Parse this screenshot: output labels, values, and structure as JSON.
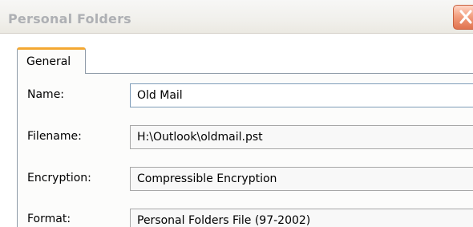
{
  "window": {
    "title": "Personal Folders"
  },
  "tabs": [
    {
      "label": "General",
      "selected": true
    }
  ],
  "fields": {
    "name": {
      "label": "Name:",
      "value": "Old Mail"
    },
    "filename": {
      "label": "Filename:",
      "value": "H:\\Outlook\\oldmail.pst"
    },
    "encryption": {
      "label": "Encryption:",
      "value": "Compressible Encryption"
    },
    "format": {
      "label": "Format:",
      "value": "Personal Folders File (97-2002)"
    }
  },
  "colors": {
    "tab_accent": "#f4a832",
    "close_button": "#e0734f"
  },
  "icons": {
    "close": "close-icon"
  }
}
